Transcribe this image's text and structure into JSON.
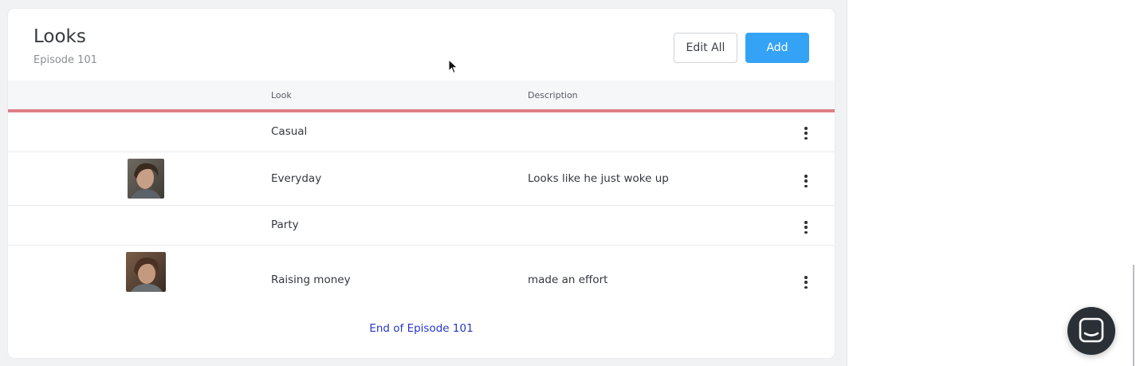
{
  "page": {
    "title": "Looks",
    "subtitle": "Episode 101"
  },
  "toolbar": {
    "edit_all_label": "Edit All",
    "add_label": "Add"
  },
  "table": {
    "columns": [
      "",
      "Look",
      "Description"
    ],
    "rows": [
      {
        "look": "Casual",
        "description": "",
        "has_image": false
      },
      {
        "look": "Everyday",
        "description": "Looks like he just woke up",
        "has_image": true
      },
      {
        "look": "Party",
        "description": "",
        "has_image": false
      },
      {
        "look": "Raising money",
        "description": "made an effort",
        "has_image": true
      }
    ]
  },
  "footer": {
    "end_label": "End of Episode 101"
  },
  "colors": {
    "accent_blue": "#34a3f6",
    "header_underline": "#df7f86",
    "link_blue": "#2536c9",
    "chat_bubble": "#2b3037"
  },
  "icons": {
    "row_menu": "kebab-menu-icon",
    "chat": "chat-icon",
    "cursor": "mouse-pointer-icon"
  }
}
